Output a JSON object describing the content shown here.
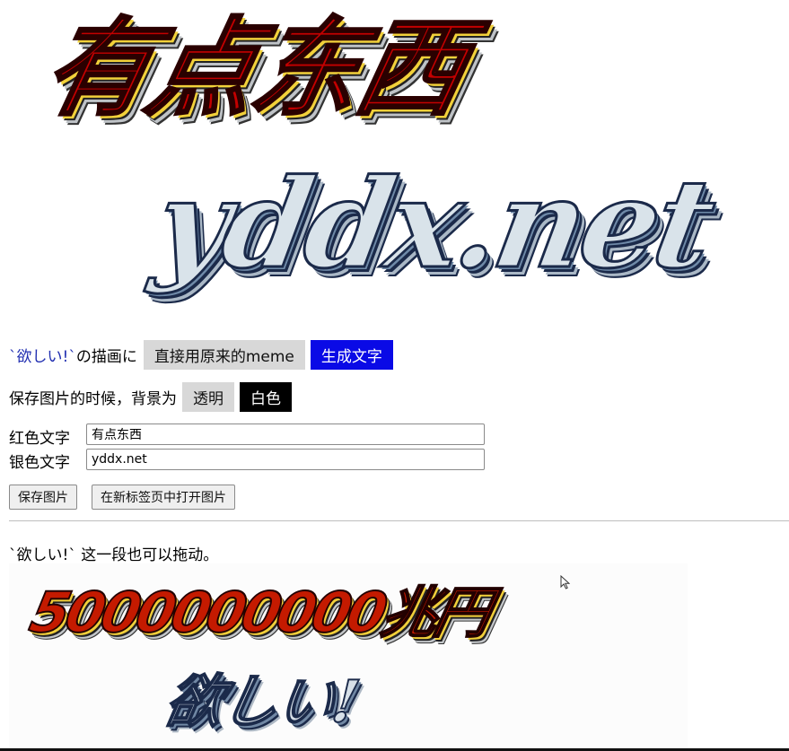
{
  "logo": {
    "red_text": "有点东西",
    "silver_text": "yddx.net"
  },
  "render_mode": {
    "prefix": "`欲しい!`",
    "middle": " の描画に",
    "option_original": "直接用原来的meme",
    "option_generate": "生成文字",
    "selected": "生成文字"
  },
  "background": {
    "label": "保存图片的时候，背景为",
    "option_transparent": "透明",
    "option_white": "白色",
    "selected": "白色"
  },
  "inputs": {
    "red_label": "红色文字",
    "red_value": "有点东西",
    "silver_label": "银色文字",
    "silver_value": "yddx.net"
  },
  "buttons": {
    "save": "保存图片",
    "open_new_tab": "在新标签页中打开图片"
  },
  "drag_note": "`欲しい!` 这一段也可以拖动。",
  "preview": {
    "red_text": "5000000000兆円",
    "silver_text": "欲しい!"
  },
  "colors": {
    "accent_blue": "#0a0ae6",
    "selected_black": "#000000",
    "unselected_gray": "#d8d8d8"
  }
}
